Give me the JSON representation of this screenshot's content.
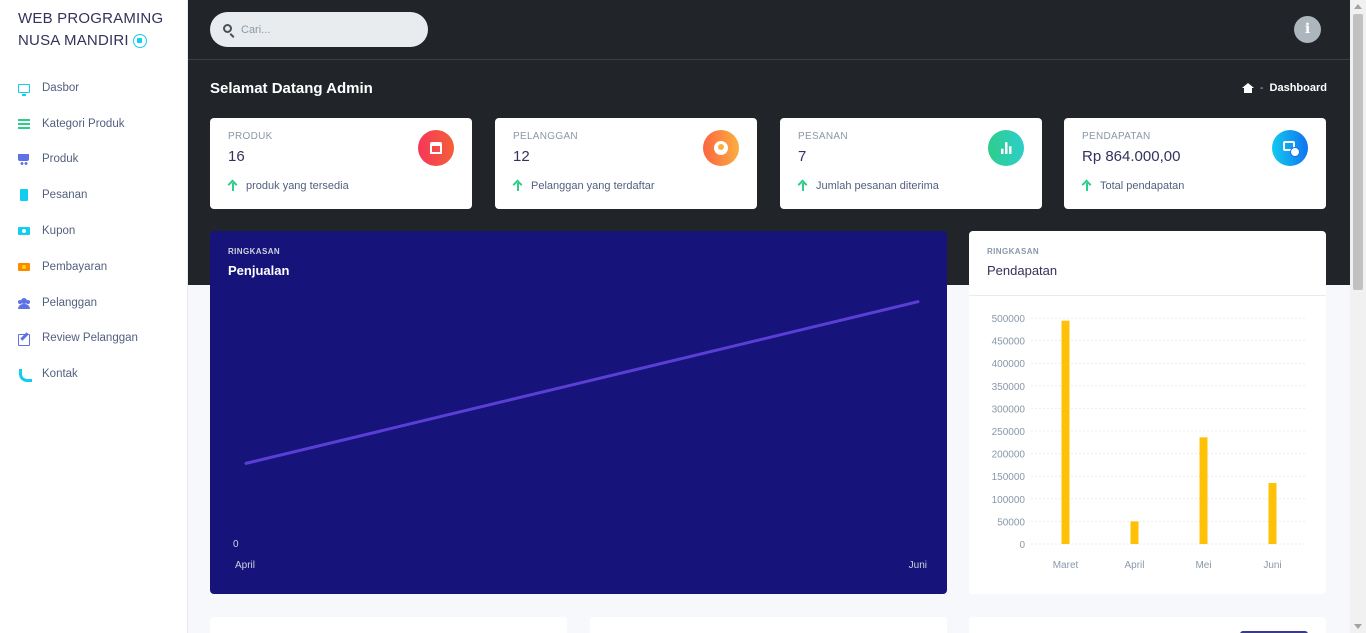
{
  "brand": {
    "line1": "WEB PROGRAMING",
    "line2": "NUSA MANDIRI"
  },
  "sidebar": {
    "items": [
      {
        "label": "Dasbor",
        "icon": "monitor-icon"
      },
      {
        "label": "Kategori Produk",
        "icon": "list-icon"
      },
      {
        "label": "Produk",
        "icon": "cart-icon"
      },
      {
        "label": "Pesanan",
        "icon": "document-icon"
      },
      {
        "label": "Kupon",
        "icon": "money-icon"
      },
      {
        "label": "Pembayaran",
        "icon": "payment-icon"
      },
      {
        "label": "Pelanggan",
        "icon": "users-icon"
      },
      {
        "label": "Review Pelanggan",
        "icon": "edit-icon"
      },
      {
        "label": "Kontak",
        "icon": "phone-icon"
      }
    ]
  },
  "search": {
    "placeholder": "Cari..."
  },
  "header": {
    "title": "Selamat Datang Admin",
    "breadcrumb": "Dashboard"
  },
  "stats": [
    {
      "label": "PRODUK",
      "value": "16",
      "note": "produk yang tersedia",
      "icon": "store-icon",
      "color": "#f5365c"
    },
    {
      "label": "PELANGGAN",
      "value": "12",
      "note": "Pelanggan yang terdaftar",
      "icon": "user-icon",
      "color": "#fb6340"
    },
    {
      "label": "PESANAN",
      "value": "7",
      "note": "Jumlah pesanan diterima",
      "icon": "bar-chart-icon",
      "color": "#2dce89"
    },
    {
      "label": "PENDAPATAN",
      "value": "Rp 864.000,00",
      "note": "Total pendapatan",
      "icon": "money-stack-icon",
      "color": "#11cdef"
    }
  ],
  "sales_card": {
    "subtitle": "RINGKASAN",
    "title": "Penjualan"
  },
  "revenue_card": {
    "subtitle": "RINGKASAN",
    "title": "Pendapatan"
  },
  "chart_data": [
    {
      "type": "line",
      "title": "Penjualan",
      "x": [
        "April",
        "Juni"
      ],
      "y_ticks": [
        "0"
      ],
      "series": [
        {
          "values": [
            0.33,
            1
          ]
        }
      ],
      "color": "#5a3fd6",
      "grid": false
    },
    {
      "type": "bar",
      "title": "Pendapatan",
      "categories": [
        "Maret",
        "April",
        "Mei",
        "Juni"
      ],
      "values": [
        494000,
        50000,
        236000,
        135000
      ],
      "ylim": [
        0,
        500000
      ],
      "y_ticks": [
        "0",
        "50000",
        "100000",
        "150000",
        "200000",
        "250000",
        "300000",
        "350000",
        "400000",
        "450000",
        "500000"
      ],
      "color": "#ffc107",
      "grid": true
    }
  ]
}
